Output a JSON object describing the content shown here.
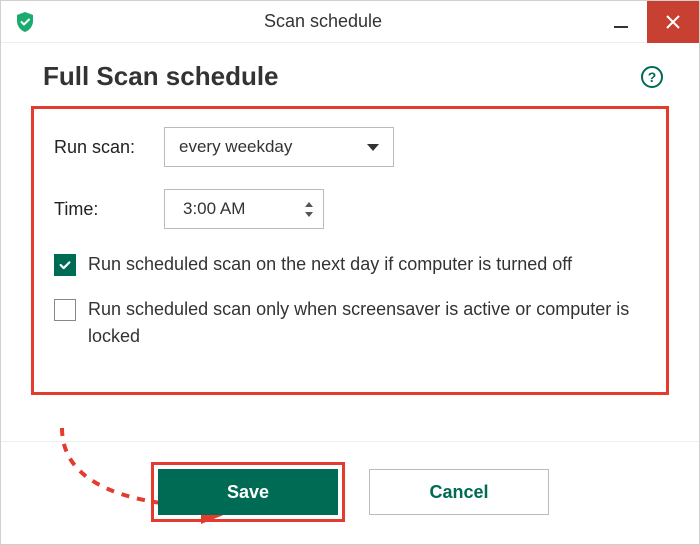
{
  "window": {
    "title": "Scan schedule"
  },
  "header": {
    "title": "Full Scan schedule"
  },
  "form": {
    "run_scan_label": "Run scan:",
    "run_scan_value": "every weekday",
    "time_label": "Time:",
    "time_value": "3:00 AM",
    "checkbox1_label": "Run scheduled scan on the next day if computer is turned off",
    "checkbox1_checked": true,
    "checkbox2_label": "Run scheduled scan only when screensaver is active or computer is locked",
    "checkbox2_checked": false
  },
  "buttons": {
    "save": "Save",
    "cancel": "Cancel"
  },
  "help_glyph": "?",
  "colors": {
    "brand_green": "#006b54",
    "highlight_red": "#e33b2e",
    "close_red": "#c84031"
  }
}
